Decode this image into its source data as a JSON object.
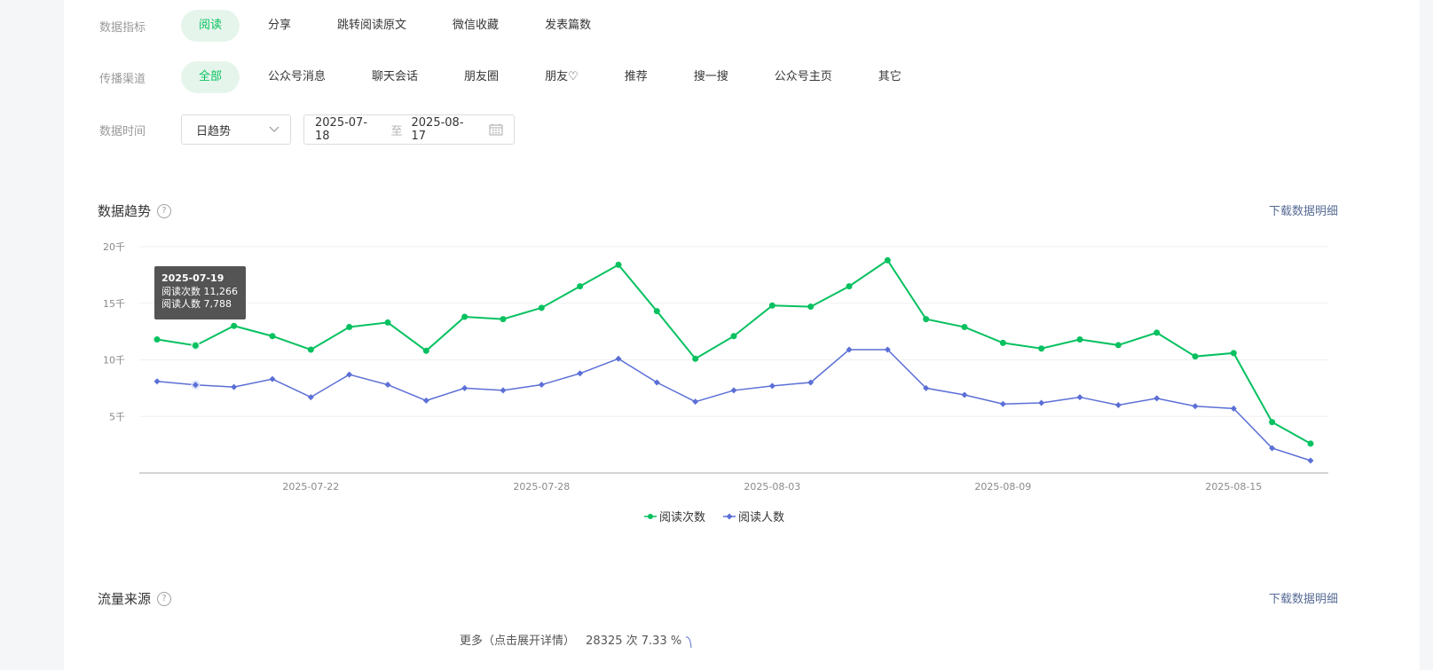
{
  "filters": {
    "metric": {
      "label": "数据指标",
      "options": [
        "阅读",
        "分享",
        "跳转阅读原文",
        "微信收藏",
        "发表篇数"
      ],
      "active": 0
    },
    "channel": {
      "label": "传播渠道",
      "options": [
        "全部",
        "公众号消息",
        "聊天会话",
        "朋友圈",
        "朋友♡",
        "推荐",
        "搜一搜",
        "公众号主页",
        "其它"
      ],
      "active": 0
    },
    "time": {
      "label": "数据时间",
      "granularity": "日趋势",
      "start_date": "2025-07-18",
      "separator": "至",
      "end_date": "2025-08-17"
    }
  },
  "trend_section": {
    "title": "数据趋势",
    "download_label": "下载数据明细"
  },
  "tooltip": {
    "date": "2025-07-19",
    "line1": "阅读次数 11,266",
    "line2": "阅读人数 7,788"
  },
  "chart_data": {
    "type": "line",
    "x": [
      "2025-07-18",
      "2025-07-19",
      "2025-07-20",
      "2025-07-21",
      "2025-07-22",
      "2025-07-23",
      "2025-07-24",
      "2025-07-25",
      "2025-07-26",
      "2025-07-27",
      "2025-07-28",
      "2025-07-29",
      "2025-07-30",
      "2025-07-31",
      "2025-08-01",
      "2025-08-02",
      "2025-08-03",
      "2025-08-04",
      "2025-08-05",
      "2025-08-06",
      "2025-08-07",
      "2025-08-08",
      "2025-08-09",
      "2025-08-10",
      "2025-08-11",
      "2025-08-12",
      "2025-08-13",
      "2025-08-14",
      "2025-08-15",
      "2025-08-16",
      "2025-08-17"
    ],
    "x_tick_labels": [
      "2025-07-22",
      "2025-07-28",
      "2025-08-03",
      "2025-08-09",
      "2025-08-15"
    ],
    "y_tick_labels": [
      "5千",
      "10千",
      "15千",
      "20千"
    ],
    "y_ticks": [
      5000,
      10000,
      15000,
      20000
    ],
    "ylim": [
      0,
      20000
    ],
    "grid": true,
    "legend_position": "bottom",
    "series": [
      {
        "name": "阅读次数",
        "color": "#07c160",
        "values": [
          11800,
          11266,
          13000,
          12100,
          10900,
          12900,
          13300,
          10800,
          13800,
          13600,
          14600,
          16500,
          18400,
          14300,
          10100,
          12100,
          14800,
          14700,
          16500,
          18800,
          13600,
          12900,
          11500,
          11000,
          11800,
          11300,
          12400,
          10300,
          10600,
          4500,
          2600
        ]
      },
      {
        "name": "阅读人数",
        "color": "#5b6fd6",
        "values": [
          8100,
          7788,
          7600,
          8300,
          6700,
          8700,
          7800,
          6400,
          7500,
          7300,
          7800,
          8800,
          10100,
          8000,
          6300,
          7300,
          7700,
          8000,
          10900,
          10900,
          7500,
          6900,
          6100,
          6200,
          6700,
          6000,
          6600,
          5900,
          5700,
          2200,
          1100
        ]
      }
    ]
  },
  "traffic_section": {
    "title": "流量来源",
    "download_label": "下载数据明细",
    "more_label": "更多（点击展开详情）",
    "more_value": "28325 次 7.33 %"
  }
}
